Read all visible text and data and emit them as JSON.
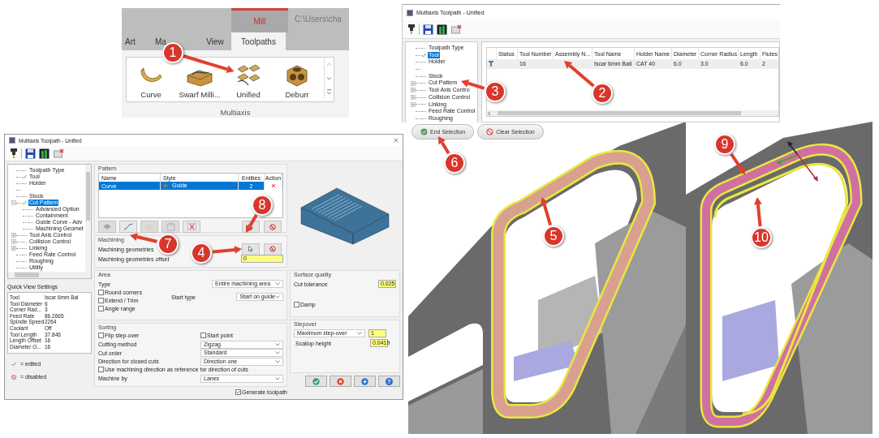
{
  "ribbon": {
    "context_tab": "Mill",
    "file_path": "C:\\Users\\cha",
    "tabs": [
      {
        "label": "Art",
        "selected": false
      },
      {
        "label": "Ma",
        "selected": false
      },
      {
        "label": "View",
        "selected": false
      },
      {
        "label": "Toolpaths",
        "selected": true
      }
    ],
    "buttons": [
      {
        "label": "Curve",
        "kind": "curve"
      },
      {
        "label": "Swarf Milli...",
        "kind": "swarf"
      },
      {
        "label": "Unified",
        "kind": "unified"
      },
      {
        "label": "Deburr",
        "kind": "deburr"
      }
    ],
    "group_label": "Multiaxis"
  },
  "tool_dialog": {
    "title": "Multiaxis Toolpath - Unified",
    "tree": [
      {
        "kind": "item",
        "label": "Toolpath Type",
        "selected": false,
        "edited": false
      },
      {
        "kind": "item",
        "label": "Tool",
        "selected": true,
        "edited": true
      },
      {
        "kind": "item",
        "label": "Holder",
        "selected": false,
        "edited": false
      },
      {
        "kind": "gap"
      },
      {
        "kind": "item",
        "label": "Stock",
        "selected": false,
        "edited": false
      },
      {
        "kind": "item",
        "label": "Cut Pattern",
        "selected": false,
        "edited": false,
        "expanded": false
      },
      {
        "kind": "item",
        "label": "Tool Axis Contro",
        "selected": false,
        "edited": false,
        "expanded": false
      },
      {
        "kind": "item",
        "label": "Collision Control",
        "selected": false,
        "edited": false,
        "expanded": false
      },
      {
        "kind": "item",
        "label": "Linking",
        "selected": false,
        "edited": false,
        "expanded": false
      },
      {
        "kind": "item",
        "label": "Feed Rate Control",
        "selected": false,
        "edited": false
      },
      {
        "kind": "item",
        "label": "Roughing",
        "selected": false,
        "edited": false
      }
    ],
    "table": {
      "columns": [
        "Status",
        "Tool Number",
        "Assembly N...",
        "Tool Name",
        "Holder Name",
        "Diameter",
        "Corner Radius",
        "Length",
        "Flutes"
      ],
      "rows": [
        {
          "cells": [
            null,
            "16",
            null,
            "Iscar 6mm Ball",
            "CAT 40",
            "6.0",
            "3.0",
            "6.0",
            "2"
          ],
          "selected": false
        }
      ]
    }
  },
  "selection_buttons": [
    {
      "kind": "end",
      "label": "End Selection"
    },
    {
      "kind": "clear",
      "label": "Clear Selection"
    }
  ],
  "toolpath_dialog": {
    "title": "Multiaxis Toolpath - Unified",
    "tree": [
      {
        "kind": "item",
        "label": "Toolpath Type",
        "selected": false,
        "edited": false
      },
      {
        "kind": "item",
        "label": "Tool",
        "selected": false,
        "edited": true
      },
      {
        "kind": "item",
        "label": "Holder",
        "selected": false,
        "edited": false
      },
      {
        "kind": "gap"
      },
      {
        "kind": "item",
        "label": "Stock",
        "selected": false,
        "edited": false
      },
      {
        "kind": "item",
        "label": "Cut Pattern",
        "selected": true,
        "edited": true,
        "expanded": true,
        "children": [
          {
            "kind": "item",
            "label": "Advanced Option",
            "selected": false,
            "edited": false
          },
          {
            "kind": "item",
            "label": "Containment",
            "selected": false,
            "edited": false
          },
          {
            "kind": "item",
            "label": "Guide Curve - Adv",
            "selected": false,
            "edited": false
          },
          {
            "kind": "item",
            "label": "Machining Geomet",
            "selected": false,
            "edited": false
          }
        ]
      },
      {
        "kind": "item",
        "label": "Tool Axis Control",
        "selected": false,
        "edited": false,
        "expanded": false
      },
      {
        "kind": "item",
        "label": "Collision Control",
        "selected": false,
        "edited": false,
        "expanded": false
      },
      {
        "kind": "item",
        "label": "Linking",
        "selected": false,
        "edited": false,
        "expanded": false
      },
      {
        "kind": "item",
        "label": "Feed Rate Control",
        "selected": false,
        "edited": false
      },
      {
        "kind": "item",
        "label": "Roughing",
        "selected": false,
        "edited": false
      },
      {
        "kind": "item",
        "label": "Utility",
        "selected": false,
        "edited": false
      }
    ],
    "quick_view": {
      "title": "Quick View Settings",
      "rows": [
        {
          "name": "Tool",
          "value": "Iscar 6mm Bal"
        },
        {
          "name": "Tool Diameter",
          "value": "6"
        },
        {
          "name": "Corner Rad...",
          "value": "3"
        },
        {
          "name": "Feed Rate",
          "value": "86.2665"
        },
        {
          "name": "Spindle Speed",
          "value": "2264"
        },
        {
          "name": "Coolant",
          "value": "Off"
        },
        {
          "name": "Tool Length",
          "value": "37.846"
        },
        {
          "name": "Length Offset",
          "value": "16"
        },
        {
          "name": "Diameter O...",
          "value": "16"
        }
      ]
    },
    "legend": [
      {
        "kind": "edited",
        "label": "= edited"
      },
      {
        "kind": "disabled",
        "label": "= disabled"
      }
    ],
    "pattern": {
      "title": "Pattern",
      "columns": [
        "Name",
        "Style",
        "Entities",
        "Action"
      ],
      "rows": [
        {
          "name": "Curve",
          "style": "Guide",
          "entities": "2",
          "selected": true
        }
      ],
      "tools": [
        {
          "kind": "surface",
          "disabled": true
        },
        {
          "kind": "curve",
          "disabled": false
        },
        {
          "kind": "lines",
          "disabled": true
        },
        {
          "kind": "box",
          "disabled": true
        },
        {
          "kind": "delete",
          "disabled": false
        }
      ]
    },
    "machining": {
      "title": "Machining",
      "geometries_label": "Machining geometries",
      "offset_label": "Machining geometries offset",
      "offset_value": "0"
    },
    "area": {
      "title": "Area",
      "type_label": "Type",
      "type_value": "Entire machining area",
      "options": [
        {
          "label": "Round corners",
          "checked": false
        },
        {
          "label": "Extend / Trim",
          "checked": false
        },
        {
          "label": "Angle range",
          "checked": false
        }
      ],
      "start_type_label": "Start type",
      "start_type_value": "Start on guide"
    },
    "sorting": {
      "title": "Sorting",
      "flip": {
        "label": "Flip step-over",
        "checked": false
      },
      "start_point": {
        "label": "Start point",
        "checked": false
      },
      "fields": [
        {
          "label": "Cutting method",
          "value": "Zigzag"
        },
        {
          "label": "Cut order",
          "value": "Standard"
        },
        {
          "label": "Direction for closed cuts",
          "value": "Direction one"
        }
      ],
      "use_direction": {
        "label": "Use machining direction as reference for direction of cuts",
        "checked": false
      },
      "machine_by": {
        "label": "Machine by",
        "value": "Lanes"
      }
    },
    "generate": {
      "label": "Generate toolpath",
      "checked": true
    },
    "surface_quality": {
      "title": "Surface quality",
      "tolerance_label": "Cut tolerance",
      "tolerance_value": "0.025",
      "damp": {
        "label": "Damp",
        "checked": false
      }
    },
    "stepover": {
      "title": "Stepover",
      "mode": "Maximum step-over",
      "value": "1",
      "scallop_label": "Scallop height",
      "scallop_value": "0.0419"
    },
    "buttons": [
      {
        "kind": "ok"
      },
      {
        "kind": "cancel"
      },
      {
        "kind": "add"
      },
      {
        "kind": "help",
        "label": "?"
      }
    ]
  },
  "callouts": [
    "1",
    "2",
    "3",
    "4",
    "5",
    "6",
    "7",
    "8",
    "9",
    "10"
  ]
}
